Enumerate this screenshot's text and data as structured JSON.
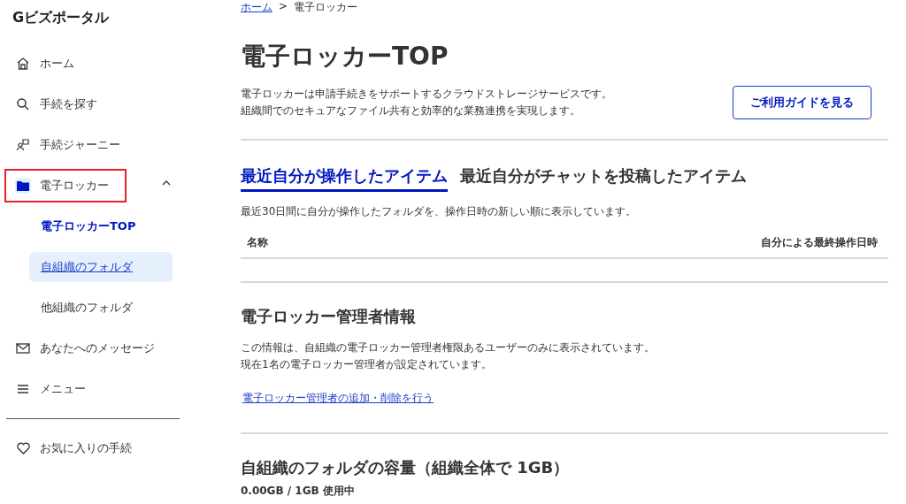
{
  "sidebar": {
    "title": "Gビズポータル",
    "items": [
      {
        "label": "ホーム",
        "highlighted": false
      },
      {
        "label": "手続を探す",
        "highlighted": false
      },
      {
        "label": "手続ジャーニー",
        "highlighted": false
      },
      {
        "label": "電子ロッカー",
        "highlighted": true,
        "expanded": true,
        "children": [
          {
            "label": "電子ロッカーTOP",
            "current": true,
            "selected": false
          },
          {
            "label": "自組織のフォルダ",
            "current": false,
            "selected": true
          },
          {
            "label": "他組織のフォルダ",
            "current": false,
            "selected": false
          }
        ]
      },
      {
        "label": "あなたへのメッセージ",
        "highlighted": false
      },
      {
        "label": "メニュー",
        "highlighted": false
      }
    ],
    "favorites": {
      "label": "お気に入りの手続"
    }
  },
  "breadcrumb": [
    {
      "label": "ホーム",
      "link": true
    },
    {
      "label": "電子ロッカー",
      "link": false
    }
  ],
  "breadcrumb_separator": ">",
  "page": {
    "title": "電子ロッカーTOP",
    "description": [
      "電子ロッカーは申請手続きをサポートするクラウドストレージサービスです。",
      "組織間でのセキュアなファイル共有と効率的な業務連携を実現します。"
    ],
    "guide_button": "ご利用ガイドを見る"
  },
  "tabs": [
    {
      "label": "最近自分が操作したアイテム",
      "selected": true
    },
    {
      "label": "最近自分がチャットを投稿したアイテム",
      "selected": false
    }
  ],
  "recent": {
    "note": "最近30日間に自分が操作したフォルダを、操作日時の新しい順に表示しています。",
    "columns": [
      "名称",
      "自分による最終操作日時"
    ]
  },
  "admin": {
    "title": "電子ロッカー管理者情報",
    "text": [
      "この情報は、自組織の電子ロッカー管理者権限あるユーザーのみに表示されています。",
      "現在1名の電子ロッカー管理者が設定されています。"
    ],
    "link": "電子ロッカー管理者の追加・削除を行う"
  },
  "capacity": {
    "title": "自組織のフォルダの容量（組織全体で 1GB）",
    "usage": "0.00GB / 1GB 使用中"
  }
}
